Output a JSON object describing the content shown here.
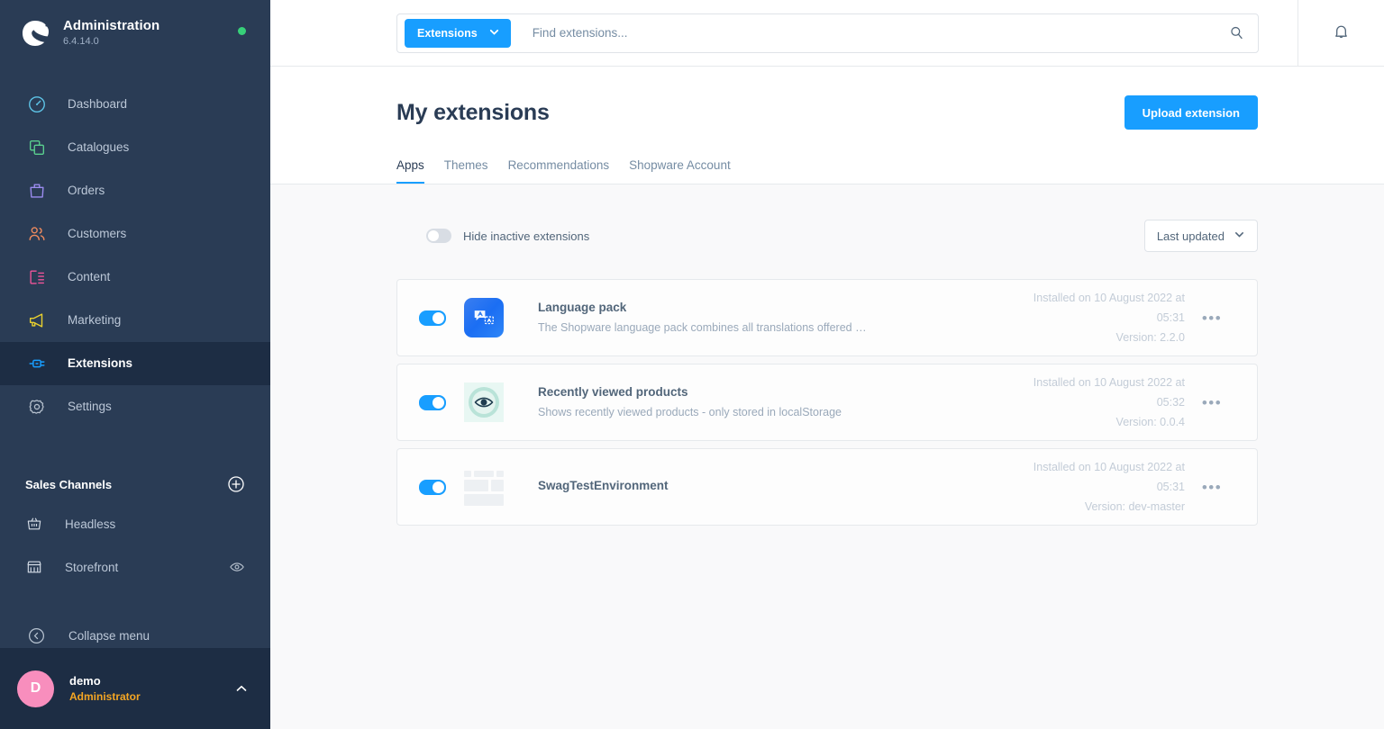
{
  "sidebar": {
    "brand": {
      "title": "Administration",
      "version": "6.4.14.0",
      "logo_icon": "shopware-logo",
      "status_icon": "status-dot-online"
    },
    "items": [
      {
        "label": "Dashboard",
        "icon": "dashboard-gauge-icon",
        "color": "#5ec5e8",
        "active": false
      },
      {
        "label": "Catalogues",
        "icon": "catalogues-copy-icon",
        "color": "#5ad08f",
        "active": false
      },
      {
        "label": "Orders",
        "icon": "orders-bag-icon",
        "color": "#9b8cf0",
        "active": false
      },
      {
        "label": "Customers",
        "icon": "customers-people-icon",
        "color": "#ef8b5e",
        "active": false
      },
      {
        "label": "Content",
        "icon": "content-layout-icon",
        "color": "#f0549a",
        "active": false
      },
      {
        "label": "Marketing",
        "icon": "marketing-megaphone-icon",
        "color": "#ead12e",
        "active": false
      },
      {
        "label": "Extensions",
        "icon": "extensions-plug-icon",
        "color": "#189eff",
        "active": true
      },
      {
        "label": "Settings",
        "icon": "settings-gear-icon",
        "color": "#b5c0cd",
        "active": false
      }
    ],
    "sales_channels": {
      "title": "Sales Channels",
      "add_icon": "plus-circle-icon",
      "items": [
        {
          "label": "Headless",
          "icon": "basket-icon",
          "trailing_icon": null
        },
        {
          "label": "Storefront",
          "icon": "storefront-icon",
          "trailing_icon": "eye-icon"
        }
      ]
    },
    "collapse": {
      "label": "Collapse menu",
      "icon": "chevron-left-circle-icon"
    },
    "user": {
      "initial": "D",
      "name": "demo",
      "role": "Administrator",
      "caret_icon": "chevron-up-icon"
    }
  },
  "topbar": {
    "scope": {
      "label": "Extensions",
      "caret_icon": "chevron-down-icon"
    },
    "search": {
      "value": "",
      "placeholder": "Find extensions...",
      "icon": "search-icon"
    },
    "notifications_icon": "bell-icon"
  },
  "page": {
    "title": "My extensions",
    "upload_label": "Upload extension",
    "tabs": [
      {
        "label": "Apps",
        "active": true
      },
      {
        "label": "Themes",
        "active": false
      },
      {
        "label": "Recommendations",
        "active": false
      },
      {
        "label": "Shopware Account",
        "active": false
      }
    ]
  },
  "filters": {
    "hide_inactive": {
      "label": "Hide inactive extensions",
      "on": false
    },
    "sort": {
      "label": "Last updated",
      "caret_icon": "chevron-down-icon"
    }
  },
  "extensions": [
    {
      "name": "Language pack",
      "description": "The Shopware language pack combines all translations offered by Shop…",
      "installed_line1": "Installed on 10 August 2022 at",
      "installed_line2": "05:31",
      "version_line": "Version: 2.2.0",
      "active": true,
      "icon": "language-pack-icon",
      "menu_icon": "context-menu-dots-icon"
    },
    {
      "name": "Recently viewed products",
      "description": "Shows recently viewed products - only stored in localStorage",
      "installed_line1": "Installed on 10 August 2022 at",
      "installed_line2": "05:32",
      "version_line": "Version: 0.0.4",
      "active": true,
      "icon": "recently-viewed-eye-icon",
      "menu_icon": "context-menu-dots-icon"
    },
    {
      "name": "SwagTestEnvironment",
      "description": "",
      "installed_line1": "Installed on 10 August 2022 at",
      "installed_line2": "05:31",
      "version_line": "Version: dev-master",
      "active": true,
      "icon": "placeholder-skeleton-icon",
      "menu_icon": "context-menu-dots-icon"
    }
  ],
  "colors": {
    "accent": "#189eff",
    "sidebar": "#2a3c55",
    "sidebar_active": "#1d2d44",
    "online": "#37d079",
    "role": "#f5a623"
  }
}
